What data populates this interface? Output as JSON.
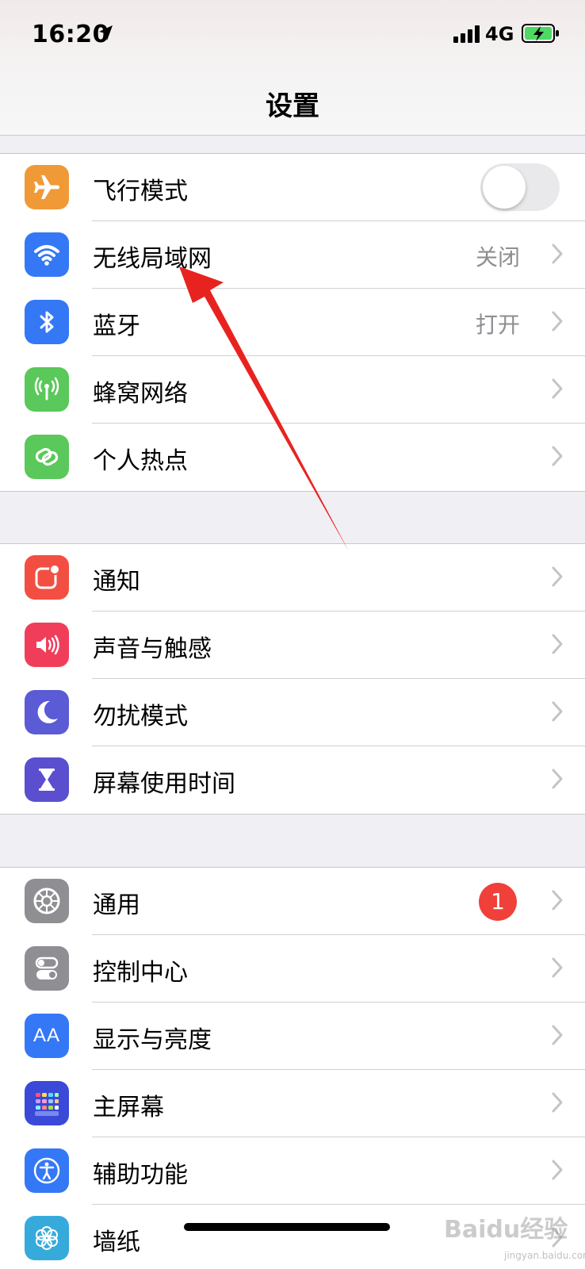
{
  "status_bar": {
    "time": "16:20",
    "network": "4G",
    "icons": [
      "location-arrow-icon",
      "cellular-signal-icon",
      "battery-charging-icon"
    ]
  },
  "nav": {
    "title": "设置"
  },
  "groups": [
    {
      "rows": [
        {
          "label": "飞行模式",
          "icon": "airplane-icon",
          "icon_color": "#f09a37",
          "control": "toggle",
          "toggle_on": false
        },
        {
          "label": "无线局域网",
          "icon": "wifi-icon",
          "icon_color": "#3478f6",
          "value": "关闭"
        },
        {
          "label": "蓝牙",
          "icon": "bluetooth-icon",
          "icon_color": "#3478f6",
          "value": "打开"
        },
        {
          "label": "蜂窝网络",
          "icon": "cellular-antenna-icon",
          "icon_color": "#5ac85a"
        },
        {
          "label": "个人热点",
          "icon": "hotspot-icon",
          "icon_color": "#5ac85a"
        }
      ]
    },
    {
      "rows": [
        {
          "label": "通知",
          "icon": "notification-icon",
          "icon_color": "#f24f42"
        },
        {
          "label": "声音与触感",
          "icon": "speaker-icon",
          "icon_color": "#f03e5a"
        },
        {
          "label": "勿扰模式",
          "icon": "moon-icon",
          "icon_color": "#5b5bd6"
        },
        {
          "label": "屏幕使用时间",
          "icon": "hourglass-icon",
          "icon_color": "#5b4fd0"
        }
      ]
    },
    {
      "rows": [
        {
          "label": "通用",
          "icon": "gear-icon",
          "icon_color": "#8e8e93",
          "badge": "1"
        },
        {
          "label": "控制中心",
          "icon": "toggles-icon",
          "icon_color": "#8e8e93"
        },
        {
          "label": "显示与亮度",
          "icon": "text-size-icon",
          "icon_color": "#3478f6",
          "icon_text": "AA"
        },
        {
          "label": "主屏幕",
          "icon": "home-screen-icon",
          "icon_color": "#3a49d8"
        },
        {
          "label": "辅助功能",
          "icon": "accessibility-icon",
          "icon_color": "#3478f6"
        },
        {
          "label": "墙纸",
          "icon": "wallpaper-icon",
          "icon_color": "#37aadc"
        }
      ]
    }
  ],
  "annotation": {
    "type": "red-arrow",
    "points_to": "无线局域网"
  },
  "watermark": {
    "text": "Baidu经验",
    "sub": "jingyan.baidu.com"
  },
  "colors": {
    "background": "#efeff4",
    "accent": "#3478f6",
    "badge": "#f0403a",
    "arrow": "#e8231f"
  }
}
